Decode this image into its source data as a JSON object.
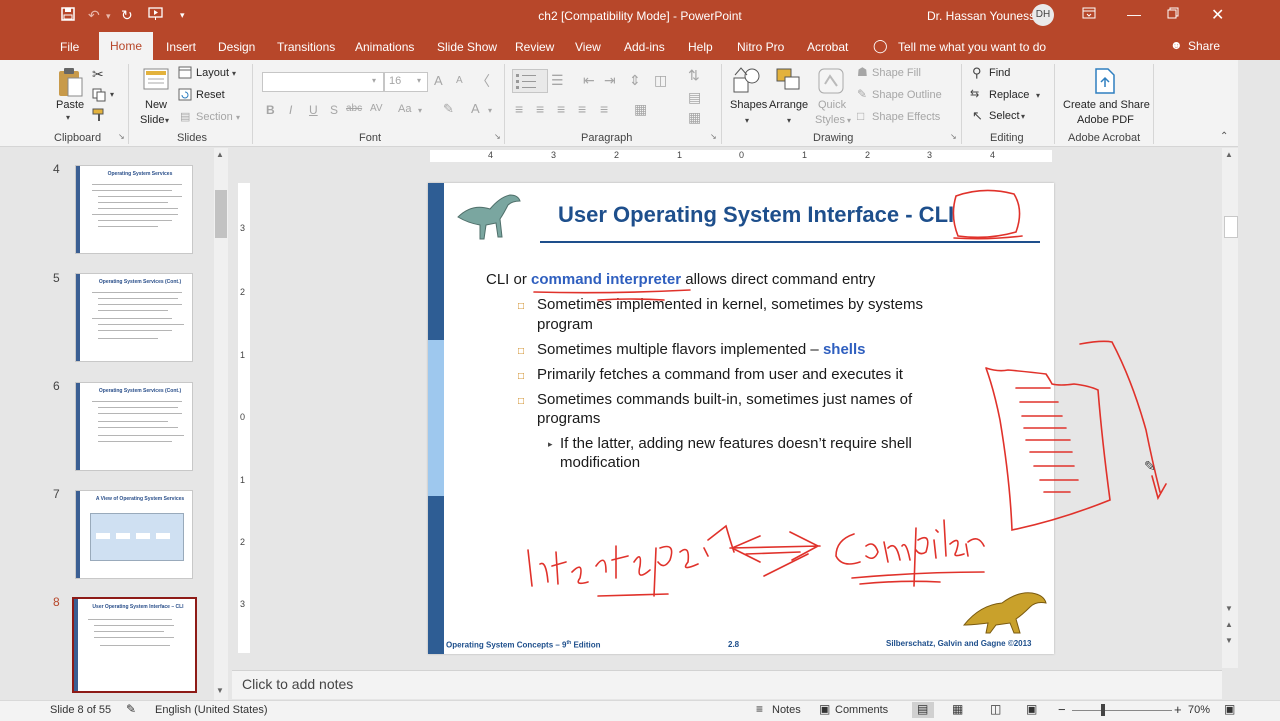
{
  "window": {
    "doc_title": "ch2 [Compatibility Mode]  -  PowerPoint",
    "user_name": "Dr. Hassan Youness",
    "avatar_initials": "DH"
  },
  "tabs": [
    "File",
    "Home",
    "Insert",
    "Design",
    "Transitions",
    "Animations",
    "Slide Show",
    "Review",
    "View",
    "Add-ins",
    "Help",
    "Nitro Pro",
    "Acrobat"
  ],
  "tell_me": "Tell me what you want to do",
  "share": "Share",
  "ribbon": {
    "clipboard": {
      "paste": "Paste",
      "group": "Clipboard"
    },
    "slides": {
      "new_slide_1": "New",
      "new_slide_2": "Slide",
      "layout": "Layout",
      "reset": "Reset",
      "section": "Section",
      "group": "Slides"
    },
    "font": {
      "size": "16",
      "group": "Font",
      "bold": "B",
      "italic": "I",
      "underline": "U",
      "strike": "S",
      "shadow": "abc",
      "spacing": "AV",
      "case": "Aa",
      "color": "A",
      "grow": "A",
      "shrink": "A"
    },
    "paragraph": {
      "group": "Paragraph"
    },
    "drawing": {
      "shapes": "Shapes",
      "arrange": "Arrange",
      "quick_styles_1": "Quick",
      "quick_styles_2": "Styles",
      "shape_fill": "Shape Fill",
      "shape_outline": "Shape Outline",
      "shape_effects": "Shape Effects",
      "group": "Drawing"
    },
    "editing": {
      "find": "Find",
      "replace": "Replace",
      "select": "Select",
      "group": "Editing"
    },
    "acrobat": {
      "create_1": "Create and Share",
      "create_2": "Adobe PDF",
      "group": "Adobe Acrobat"
    }
  },
  "thumbnails": [
    {
      "num": "4",
      "title": "Operating System Services"
    },
    {
      "num": "5",
      "title": "Operating System Services (Cont.)"
    },
    {
      "num": "6",
      "title": "Operating System Services (Cont.)"
    },
    {
      "num": "7",
      "title": "A View of Operating System Services"
    },
    {
      "num": "8",
      "title": "User Operating System Interface – CLI"
    }
  ],
  "ruler_h": [
    "4",
    "3",
    "2",
    "1",
    "0",
    "1",
    "2",
    "3",
    "4"
  ],
  "ruler_v": [
    "3",
    "2",
    "1",
    "0",
    "1",
    "2",
    "3"
  ],
  "slide": {
    "title": "User Operating System Interface - CLI",
    "intro_pre": "CLI or ",
    "intro_link": "command interpreter",
    "intro_post": " allows direct command entry",
    "bullets": [
      {
        "line1": "Sometimes implemented in kernel, sometimes by systems",
        "line2": "program"
      },
      {
        "line1": "Sometimes multiple flavors implemented – ",
        "highlight": "shells"
      },
      {
        "line1": "Primarily fetches a command from user and executes it"
      },
      {
        "line1": "Sometimes commands built-in, sometimes just names of",
        "line2": "programs"
      }
    ],
    "sub_bullet": {
      "line1": "If the latter, adding new features doesn’t require shell",
      "line2": "modification"
    },
    "footer_left": "Operating System Concepts – 9",
    "footer_sup": "th",
    "footer_left_end": " Edition",
    "footer_mid": "2.8",
    "footer_right": "Silberschatz, Galvin and Gagne ©2013"
  },
  "ink": {
    "word1": "Interpreter",
    "word2": "Compiler"
  },
  "notes_placeholder": "Click to add notes",
  "status": {
    "slide_of": "Slide 8 of 55",
    "language": "English (United States)",
    "notes": "Notes",
    "comments": "Comments",
    "zoom": "70%"
  },
  "colors": {
    "brand": "#b7472a",
    "slide_title": "#1e4f8c",
    "link": "#2f5fbf",
    "ink": "#e0322b",
    "bullet": "#c77a00"
  }
}
